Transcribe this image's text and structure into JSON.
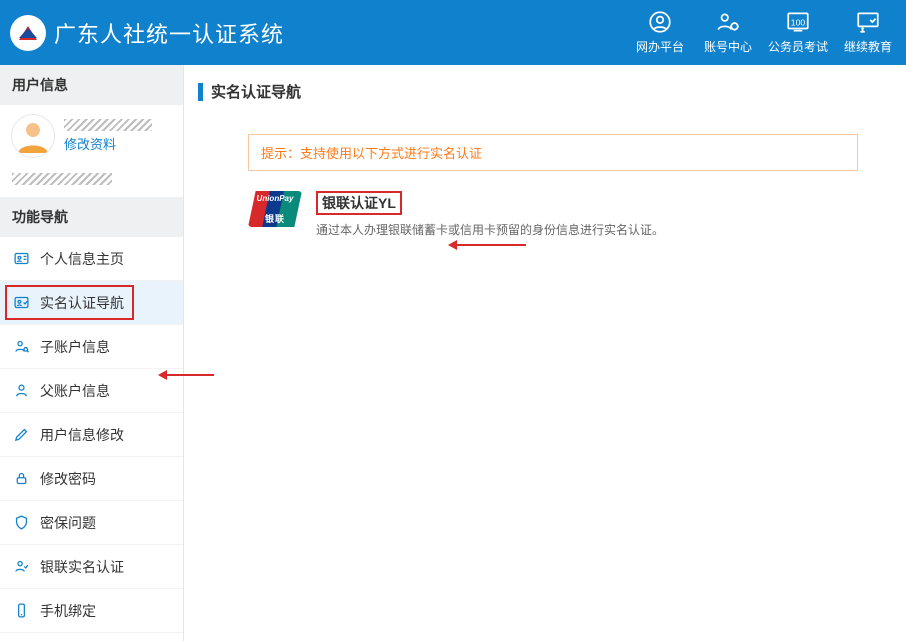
{
  "header": {
    "title": "广东人社统一认证系统",
    "nav": [
      {
        "label": "网办平台"
      },
      {
        "label": "账号中心"
      },
      {
        "label": "公务员考试"
      },
      {
        "label": "继续教育"
      }
    ]
  },
  "sidebar": {
    "userSectionTitle": "用户信息",
    "editProfile": "修改资料",
    "funcSectionTitle": "功能导航",
    "menu": [
      {
        "label": "个人信息主页"
      },
      {
        "label": "实名认证导航"
      },
      {
        "label": "子账户信息"
      },
      {
        "label": "父账户信息"
      },
      {
        "label": "用户信息修改"
      },
      {
        "label": "修改密码"
      },
      {
        "label": "密保问题"
      },
      {
        "label": "银联实名认证"
      },
      {
        "label": "手机绑定"
      }
    ]
  },
  "content": {
    "headingTitle": "实名认证导航",
    "tipText": "提示：支持使用以下方式进行实名认证",
    "authOption": {
      "logoTop": "UnionPay",
      "logoBottom": "银联",
      "title": "银联认证YL",
      "desc": "通过本人办理银联储蓄卡或信用卡预留的身份信息进行实名认证。"
    }
  }
}
